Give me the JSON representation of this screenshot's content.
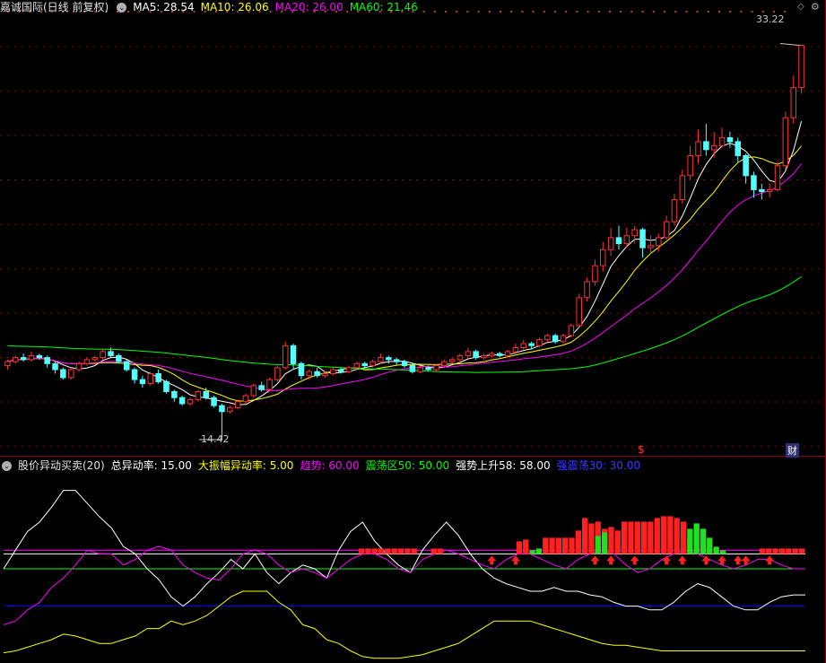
{
  "header_top": {
    "title": "嘉诚国际(日线 前复权)",
    "indicators": [
      {
        "label": "MA5: 28.54",
        "color": "#ffffff"
      },
      {
        "label": "MA10: 26.06",
        "color": "#ffff00"
      },
      {
        "label": "MA20: 26.00",
        "color": "#ff00ff"
      },
      {
        "label": "MA60: 21.46",
        "color": "#00ff00"
      }
    ]
  },
  "header_bottom": {
    "title": "股价异动买卖(20)",
    "params": [
      {
        "label": "总异动率: 15.00",
        "color": "#ffffff"
      },
      {
        "label": "大振幅异动率: 5.00",
        "color": "#ffff00"
      },
      {
        "label": "趋势: 60.00",
        "color": "#ff00ff"
      },
      {
        "label": "震荡区50: 50.00",
        "color": "#00ff00"
      },
      {
        "label": "强势上升58: 58.00",
        "color": "#ffffff"
      },
      {
        "label": "强震荡30: 30.00",
        "color": "#0000ff"
      }
    ]
  },
  "annotations": {
    "high_label": "33.22",
    "low_label": "14.42",
    "marker_s": "$",
    "marker_cai": "财"
  },
  "colors": {
    "up": "#ff3232",
    "down": "#54ffff",
    "ma5": "#ffffff",
    "ma10": "#ffff00",
    "ma20": "#ff00ff",
    "ma60": "#00ff00",
    "grid": "#8b0000"
  },
  "chart_data": [
    {
      "type": "candlestick",
      "title": "嘉诚国际(日线 前复权)",
      "ylim": [
        13.5,
        34.5
      ],
      "price_high": 33.22,
      "price_low": 14.42,
      "candles": [
        [
          17.2,
          17.4,
          17.5,
          17.0
        ],
        [
          17.4,
          17.6,
          17.7,
          17.3
        ],
        [
          17.6,
          17.5,
          17.8,
          17.4
        ],
        [
          17.5,
          17.7,
          17.9,
          17.4
        ],
        [
          17.7,
          17.6,
          17.8,
          17.5
        ],
        [
          17.6,
          17.3,
          17.7,
          17.1
        ],
        [
          17.3,
          17.0,
          17.4,
          16.8
        ],
        [
          17.0,
          16.6,
          17.1,
          16.5
        ],
        [
          16.6,
          17.0,
          17.1,
          16.5
        ],
        [
          17.0,
          17.3,
          17.4,
          16.9
        ],
        [
          17.3,
          17.5,
          17.6,
          17.2
        ],
        [
          17.5,
          17.6,
          17.7,
          17.4
        ],
        [
          17.6,
          17.9,
          18.0,
          17.5
        ],
        [
          17.9,
          17.7,
          18.1,
          17.6
        ],
        [
          17.7,
          17.4,
          17.8,
          17.3
        ],
        [
          17.4,
          17.0,
          17.5,
          16.9
        ],
        [
          17.0,
          16.5,
          17.1,
          16.3
        ],
        [
          16.5,
          16.3,
          16.7,
          16.1
        ],
        [
          16.3,
          16.8,
          16.9,
          16.2
        ],
        [
          16.8,
          16.4,
          17.0,
          16.3
        ],
        [
          16.4,
          15.9,
          16.5,
          15.8
        ],
        [
          15.9,
          15.6,
          16.0,
          15.4
        ],
        [
          15.6,
          15.3,
          15.7,
          15.2
        ],
        [
          15.3,
          15.5,
          15.6,
          15.2
        ],
        [
          15.5,
          15.9,
          16.0,
          15.4
        ],
        [
          15.9,
          15.6,
          16.1,
          15.5
        ],
        [
          15.6,
          15.2,
          15.7,
          15.1
        ],
        [
          15.2,
          14.9,
          15.3,
          14.42
        ],
        [
          14.9,
          15.1,
          15.2,
          14.8
        ],
        [
          15.1,
          15.4,
          15.5,
          15.0
        ],
        [
          15.4,
          15.7,
          15.8,
          15.3
        ],
        [
          15.7,
          16.2,
          16.3,
          15.6
        ],
        [
          16.2,
          16.0,
          16.4,
          15.9
        ],
        [
          16.0,
          16.5,
          16.6,
          15.9
        ],
        [
          16.5,
          17.1,
          17.2,
          16.4
        ],
        [
          17.1,
          18.2,
          18.4,
          17.0
        ],
        [
          18.2,
          17.3,
          18.3,
          17.0
        ],
        [
          17.3,
          16.7,
          17.4,
          16.5
        ],
        [
          16.7,
          16.9,
          17.0,
          16.5
        ],
        [
          16.9,
          16.7,
          17.1,
          16.6
        ],
        [
          16.7,
          16.8,
          16.9,
          16.6
        ],
        [
          16.8,
          17.0,
          17.1,
          16.7
        ],
        [
          17.0,
          16.9,
          17.1,
          16.8
        ],
        [
          16.9,
          17.1,
          17.2,
          16.8
        ],
        [
          17.1,
          17.3,
          17.4,
          17.0
        ],
        [
          17.3,
          17.2,
          17.4,
          17.1
        ],
        [
          17.2,
          17.4,
          17.5,
          17.1
        ],
        [
          17.4,
          17.6,
          17.8,
          17.3
        ],
        [
          17.6,
          17.5,
          17.7,
          17.3
        ],
        [
          17.5,
          17.4,
          17.6,
          17.2
        ],
        [
          17.4,
          17.2,
          17.5,
          17.1
        ],
        [
          17.2,
          16.9,
          17.3,
          16.8
        ],
        [
          16.9,
          17.1,
          17.2,
          16.8
        ],
        [
          17.1,
          17.0,
          17.2,
          16.9
        ],
        [
          17.0,
          17.2,
          17.3,
          16.9
        ],
        [
          17.2,
          17.4,
          17.5,
          17.1
        ],
        [
          17.4,
          17.5,
          17.6,
          17.3
        ],
        [
          17.5,
          17.7,
          17.8,
          17.4
        ],
        [
          17.7,
          17.9,
          18.1,
          17.6
        ],
        [
          17.9,
          17.6,
          18.0,
          17.5
        ],
        [
          17.6,
          17.7,
          17.8,
          17.5
        ],
        [
          17.7,
          17.8,
          17.9,
          17.6
        ],
        [
          17.8,
          17.7,
          17.9,
          17.6
        ],
        [
          17.7,
          17.9,
          18.0,
          17.6
        ],
        [
          17.9,
          18.1,
          18.3,
          17.8
        ],
        [
          18.1,
          18.3,
          18.5,
          18.0
        ],
        [
          18.3,
          18.2,
          18.4,
          18.0
        ],
        [
          18.2,
          18.5,
          18.6,
          18.1
        ],
        [
          18.5,
          18.7,
          18.8,
          18.4
        ],
        [
          18.7,
          18.4,
          18.8,
          18.3
        ],
        [
          18.4,
          18.7,
          18.8,
          18.3
        ],
        [
          18.7,
          19.2,
          19.3,
          18.6
        ],
        [
          19.2,
          20.6,
          20.8,
          19.1
        ],
        [
          20.6,
          21.4,
          21.6,
          20.4
        ],
        [
          21.4,
          22.2,
          22.5,
          21.2
        ],
        [
          22.2,
          23.0,
          23.4,
          21.9
        ],
        [
          23.0,
          23.6,
          24.1,
          22.7
        ],
        [
          23.6,
          23.3,
          24.2,
          23.0
        ],
        [
          23.3,
          23.7,
          24.1,
          23.1
        ],
        [
          23.7,
          24.0,
          24.2,
          23.3
        ],
        [
          24.0,
          23.1,
          24.1,
          22.6
        ],
        [
          23.1,
          23.2,
          23.7,
          22.8
        ],
        [
          23.2,
          23.6,
          23.8,
          22.9
        ],
        [
          23.6,
          24.4,
          24.7,
          23.5
        ],
        [
          24.4,
          25.5,
          25.8,
          24.2
        ],
        [
          25.5,
          26.7,
          27.0,
          25.3
        ],
        [
          26.7,
          27.7,
          28.2,
          26.5
        ],
        [
          27.7,
          28.4,
          29.0,
          27.3
        ],
        [
          28.4,
          28.0,
          29.3,
          27.7
        ],
        [
          28.0,
          28.2,
          28.9,
          27.6
        ],
        [
          28.2,
          28.6,
          29.1,
          28.1
        ],
        [
          28.6,
          28.4,
          28.9,
          28.1
        ],
        [
          28.4,
          27.7,
          28.6,
          27.4
        ],
        [
          27.7,
          26.7,
          27.8,
          26.3
        ],
        [
          26.7,
          26.0,
          26.9,
          25.6
        ],
        [
          26.0,
          25.9,
          26.3,
          25.5
        ],
        [
          25.9,
          26.0,
          26.3,
          25.6
        ],
        [
          26.0,
          27.2,
          27.4,
          25.9
        ],
        [
          27.2,
          29.6,
          29.9,
          27.0
        ],
        [
          29.6,
          31.1,
          31.7,
          29.3
        ],
        [
          31.1,
          33.22,
          33.22,
          30.8
        ]
      ]
    },
    {
      "type": "line",
      "title": "股价异动买卖(20)",
      "ylim": [
        0,
        100
      ],
      "params": {
        "总异动率": 15.0,
        "大振幅异动率": 5.0,
        "趋势": 60.0,
        "震荡区50": 50.0,
        "强势上升58": 58.0,
        "强震荡30": 30.0
      },
      "reference_lines": [
        {
          "value": 60,
          "color": "#ff00ff"
        },
        {
          "value": 50,
          "color": "#00ff00"
        },
        {
          "value": 58,
          "color": "#ffffff"
        },
        {
          "value": 30,
          "color": "#0000ff"
        }
      ],
      "series": [
        {
          "color": "#ffffff",
          "values": [
            50,
            60,
            70,
            75,
            83,
            92,
            92,
            85,
            78,
            72,
            62,
            58,
            50,
            44,
            35,
            30,
            35,
            42,
            48,
            55,
            50,
            58,
            48,
            42,
            48,
            52,
            50,
            45,
            60,
            70,
            75,
            65,
            58,
            52,
            48,
            60,
            68,
            75,
            68,
            58,
            50,
            45,
            42,
            40,
            38,
            38,
            40,
            38,
            38,
            36,
            35,
            32,
            30,
            30,
            28,
            28,
            32,
            38,
            42,
            40,
            35,
            30,
            28,
            28,
            32,
            35,
            36,
            36
          ]
        },
        {
          "color": "#ff00ff",
          "values": [
            20,
            22,
            28,
            32,
            40,
            45,
            52,
            60,
            58,
            58,
            52,
            55,
            60,
            62,
            60,
            52,
            48,
            45,
            44,
            50,
            58,
            60,
            58,
            52,
            48,
            50,
            48,
            45,
            50,
            55,
            58,
            58,
            55,
            50,
            48,
            55,
            58,
            60,
            58,
            55,
            52,
            50,
            55,
            58,
            58,
            55,
            52,
            50,
            55,
            58,
            60,
            58,
            52,
            48,
            50,
            55,
            58,
            60,
            58,
            55,
            52,
            50,
            52,
            55,
            55,
            52,
            50,
            50
          ]
        },
        {
          "color": "#ffff00",
          "values": [
            5,
            6,
            8,
            10,
            12,
            15,
            14,
            12,
            10,
            10,
            12,
            14,
            18,
            18,
            22,
            20,
            22,
            25,
            30,
            35,
            38,
            38,
            38,
            32,
            28,
            20,
            18,
            12,
            10,
            6,
            3,
            2,
            2,
            2,
            3,
            4,
            6,
            8,
            10,
            14,
            18,
            22,
            22,
            22,
            22,
            20,
            18,
            16,
            14,
            12,
            10,
            9,
            9,
            8,
            7,
            6,
            6,
            6,
            6,
            6,
            6,
            6,
            6,
            6,
            6,
            6,
            6,
            6
          ]
        }
      ],
      "histogram": {
        "start_index": 59,
        "red": [
          6,
          6,
          6,
          6,
          6,
          6,
          6,
          6,
          6,
          0,
          0,
          6,
          6,
          0,
          0,
          0,
          0,
          0,
          0,
          0,
          0,
          0,
          0,
          0,
          14,
          16,
          4,
          0,
          18,
          18,
          18,
          18,
          18,
          26,
          40,
          34,
          36,
          28,
          30,
          26,
          36,
          36,
          36,
          36,
          36,
          40,
          42,
          42,
          40,
          36,
          16,
          6,
          10,
          6,
          0,
          0,
          0,
          0,
          0,
          0,
          0,
          6,
          6,
          6,
          6,
          6,
          6,
          6
        ],
        "green": [
          0,
          0,
          0,
          0,
          0,
          0,
          0,
          0,
          0,
          0,
          0,
          0,
          0,
          0,
          0,
          0,
          0,
          0,
          0,
          0,
          0,
          0,
          0,
          0,
          0,
          0,
          4,
          6,
          0,
          0,
          0,
          0,
          0,
          0,
          0,
          0,
          20,
          24,
          0,
          0,
          0,
          0,
          0,
          0,
          0,
          0,
          0,
          0,
          0,
          0,
          28,
          34,
          28,
          18,
          8,
          4,
          0,
          0,
          0,
          0,
          0,
          0,
          0,
          0,
          0,
          0,
          0,
          0
        ]
      },
      "buy_arrows": [
        61,
        64,
        74,
        76,
        79,
        83,
        85,
        88,
        90,
        92,
        93,
        96
      ]
    }
  ]
}
